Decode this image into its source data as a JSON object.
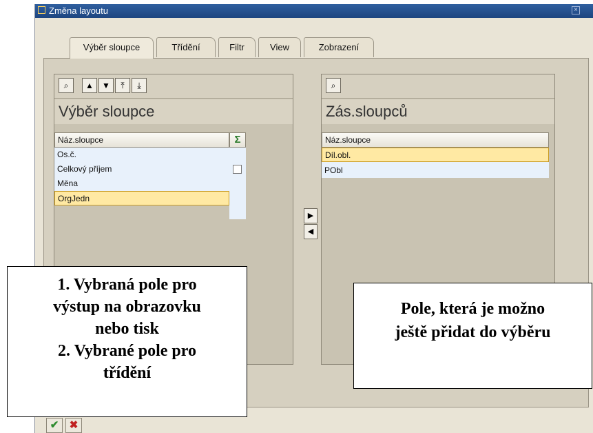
{
  "window": {
    "title": "Změna layoutu"
  },
  "tabs": [
    {
      "label": "Výběr sloupce"
    },
    {
      "label": "Třídění"
    },
    {
      "label": "Filtr"
    },
    {
      "label": "View"
    },
    {
      "label": "Zobrazení"
    }
  ],
  "left_panel": {
    "title": "Výběr sloupce",
    "column_header": "Náz.sloupce",
    "sum_icon": "Σ",
    "rows": [
      {
        "label": "Os.č."
      },
      {
        "label": "Celkový příjem"
      },
      {
        "label": "Měna"
      },
      {
        "label": "OrgJedn"
      }
    ]
  },
  "right_panel": {
    "title": "Zás.sloupců",
    "column_header": "Náz.sloupce",
    "rows": [
      {
        "label": "Díl.obl."
      },
      {
        "label": "PObl"
      }
    ]
  },
  "callouts": {
    "left": [
      "1. Vybraná pole pro",
      "výstup na obrazovku",
      "nebo tisk",
      "2. Vybrané pole pro",
      "třídění"
    ],
    "right": [
      "Pole, která je možno",
      "ještě přidat do výběru"
    ]
  },
  "colors": {
    "titlebar": "#1d4580",
    "selected_row": "#ffe9a3",
    "list_bg": "#e8f1fb"
  },
  "icons": [
    "find-icon",
    "move-up-icon",
    "move-down-icon",
    "move-top-icon",
    "move-bottom-icon",
    "arrow-right-icon",
    "arrow-left-icon",
    "confirm-icon",
    "cancel-icon"
  ]
}
